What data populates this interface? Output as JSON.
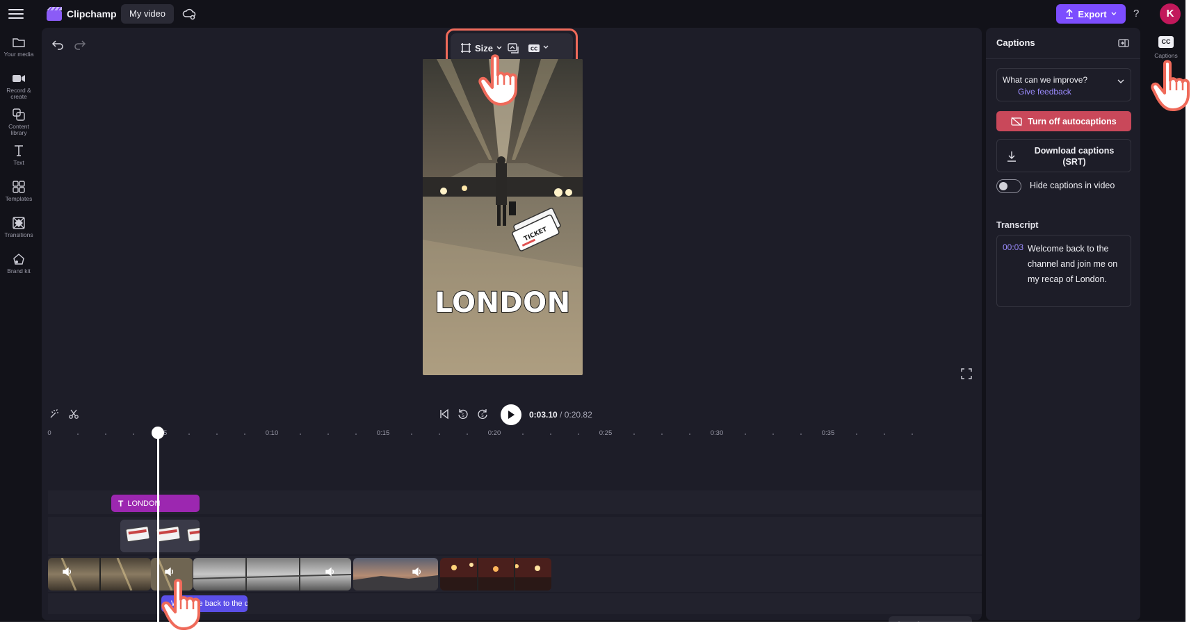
{
  "app": {
    "brand": "Clipchamp",
    "project_title": "My video"
  },
  "header": {
    "export_label": "Export",
    "help_label": "?",
    "avatar_initial": "K"
  },
  "sidebar": {
    "items": [
      {
        "label": "Your media",
        "icon": "folder-icon"
      },
      {
        "label": "Record & create",
        "icon": "camera-icon"
      },
      {
        "label": "Content library",
        "icon": "content-library-icon"
      },
      {
        "label": "Text",
        "icon": "text-icon"
      },
      {
        "label": "Templates",
        "icon": "templates-icon"
      },
      {
        "label": "Transitions",
        "icon": "transitions-icon"
      },
      {
        "label": "Brand kit",
        "icon": "brand-kit-icon"
      }
    ]
  },
  "preview_toolbar": {
    "size_label": "Size"
  },
  "preview": {
    "caption_text": "LONDON"
  },
  "playback": {
    "current_time": "0:03.10",
    "separator": " / ",
    "total_time": "0:20.82"
  },
  "ruler": {
    "labels": [
      "0",
      "0:05",
      "0:10",
      "0:15",
      "0:20",
      "0:25",
      "0:30",
      "0:35"
    ]
  },
  "timeline": {
    "text_clip_label": "LONDON",
    "caption_clip_label": "Welcome back to the channel and join me on my recap of London."
  },
  "captions_panel": {
    "title": "Captions",
    "feedback_question": "What can we improve?",
    "feedback_link": "Give feedback",
    "autocaptions_button": "Turn off autocaptions",
    "download_line1": "Download captions",
    "download_line2": "(SRT)",
    "hide_toggle_label": "Hide captions in video",
    "hide_toggle_on": false,
    "transcript_label": "Transcript",
    "transcript": [
      {
        "time": "00:03",
        "text": "Welcome back to the channel and join me on my recap of London."
      }
    ]
  },
  "right_rail": {
    "captions_tab_label": "Captions",
    "captions_tab_icon": "CC"
  },
  "colors": {
    "accent": "#7c4dff",
    "highlight": "#ef6a5a",
    "danger_button": "#c9485a",
    "text_clip": "#9c27b0",
    "caption_clip": "#5b4fe8",
    "avatar": "#c2185b"
  }
}
